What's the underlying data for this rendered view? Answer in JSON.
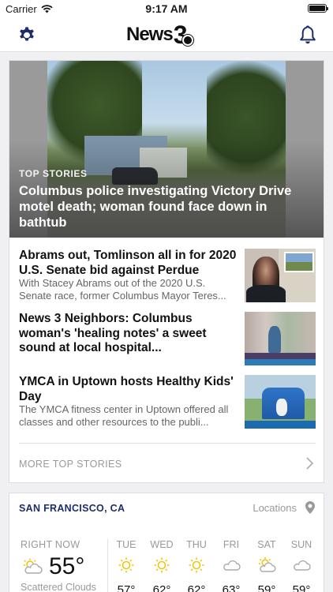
{
  "status_bar": {
    "carrier": "Carrier",
    "time": "9:17 AM",
    "battery_level": 1.0
  },
  "header": {
    "logo_text": "News",
    "logo_number": "3"
  },
  "top_stories": {
    "hero": {
      "kicker": "TOP STORIES",
      "title": "Columbus police investigating Victory Drive motel death; woman found face down in bathtub"
    },
    "items": [
      {
        "headline": "Abrams out, Tomlinson all in for 2020 U.S. Senate bid against Perdue",
        "summary": "With Stacey Abrams out of the 2020 U.S. Senate race, former Columbus Mayor Teres..."
      },
      {
        "headline": "News 3 Neighbors: Columbus woman's 'healing notes' a sweet sound at local hospital...",
        "summary": ""
      },
      {
        "headline": "YMCA in Uptown hosts Healthy Kids' Day",
        "summary": "The YMCA fitness center in Uptown offered all classes and other resources to the publi..."
      }
    ],
    "more_label": "MORE TOP STORIES"
  },
  "weather": {
    "city": "SAN FRANCISCO, CA",
    "locations_label": "Locations",
    "now": {
      "label": "RIGHT NOW",
      "temp": "55°",
      "condition": "Scattered Clouds",
      "icon": "partly-cloudy-icon"
    },
    "forecast": [
      {
        "day": "TUE",
        "hi": "57°",
        "icon": "sun-icon"
      },
      {
        "day": "WED",
        "hi": "62°",
        "icon": "sun-icon"
      },
      {
        "day": "THU",
        "hi": "62°",
        "icon": "sun-icon"
      },
      {
        "day": "FRI",
        "hi": "63°",
        "icon": "cloud-icon"
      },
      {
        "day": "SAT",
        "hi": "59°",
        "icon": "partly-cloudy-icon"
      },
      {
        "day": "SUN",
        "hi": "59°",
        "icon": "cloud-icon"
      }
    ]
  },
  "colors": {
    "accent": "#1d2d6b",
    "sun": "#f1c40f",
    "muted": "#999999"
  }
}
